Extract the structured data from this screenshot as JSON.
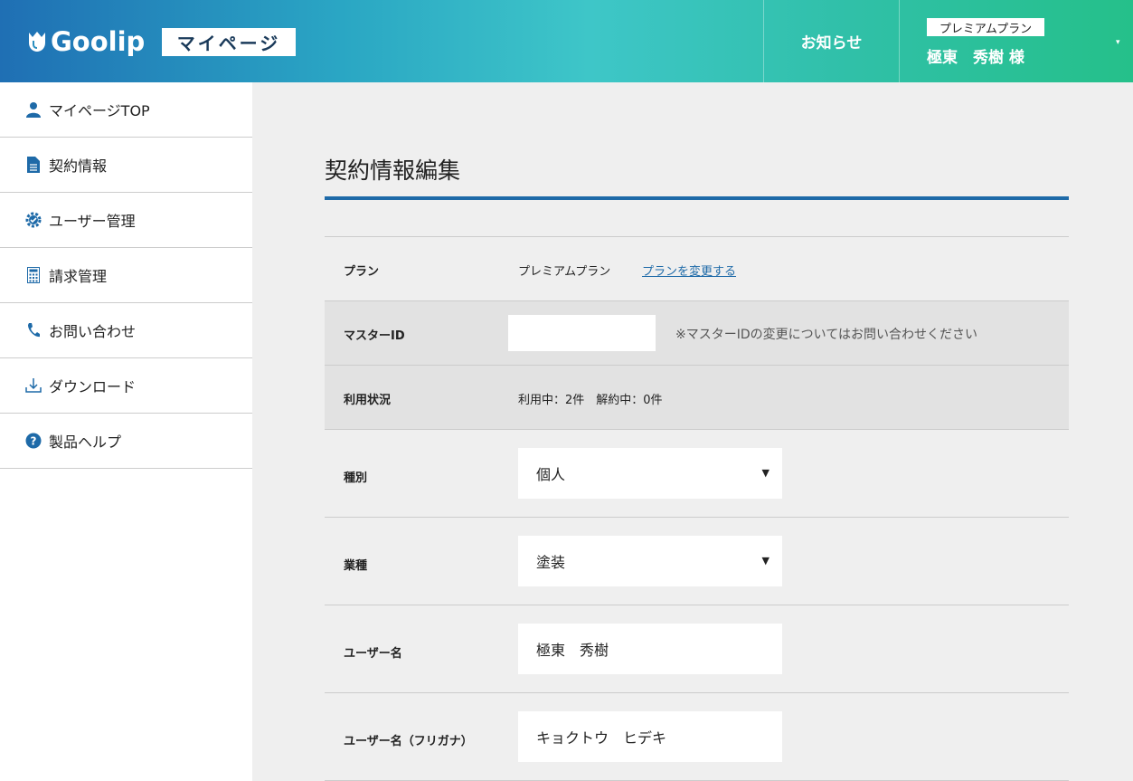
{
  "header": {
    "logo_text": "Goolip",
    "section_tag": "マイページ",
    "notice_label": "お知らせ",
    "plan_badge": "プレミアムプラン",
    "user_name": "極東　秀樹 様"
  },
  "sidebar": {
    "items": [
      {
        "label": "マイページTOP",
        "icon": "user-icon"
      },
      {
        "label": "契約情報",
        "icon": "document-icon"
      },
      {
        "label": "ユーザー管理",
        "icon": "user-settings-icon"
      },
      {
        "label": "請求管理",
        "icon": "calculator-icon"
      },
      {
        "label": "お問い合わせ",
        "icon": "phone-icon"
      },
      {
        "label": "ダウンロード",
        "icon": "download-icon"
      },
      {
        "label": "製品ヘルプ",
        "icon": "help-icon"
      }
    ]
  },
  "main": {
    "title": "契約情報編集",
    "plan": {
      "label": "プラン",
      "value": "プレミアムプラン",
      "link": "プランを変更する"
    },
    "master_id": {
      "label": "マスターID",
      "value": "",
      "note": "※マスターIDの変更についてはお問い合わせください"
    },
    "usage": {
      "label": "利用状況",
      "value": "利用中：2件　解約中：0件"
    },
    "type": {
      "label": "種別",
      "value": "個人"
    },
    "industry": {
      "label": "業種",
      "value": "塗装"
    },
    "user_name": {
      "label": "ユーザー名",
      "value": "極東　秀樹"
    },
    "user_kana": {
      "label": "ユーザー名（フリガナ）",
      "value": "キョクトウ　ヒデキ"
    }
  },
  "colors": {
    "accent": "#1e6aa8",
    "header_start": "#1f6fb4",
    "header_end": "#25c08a"
  }
}
